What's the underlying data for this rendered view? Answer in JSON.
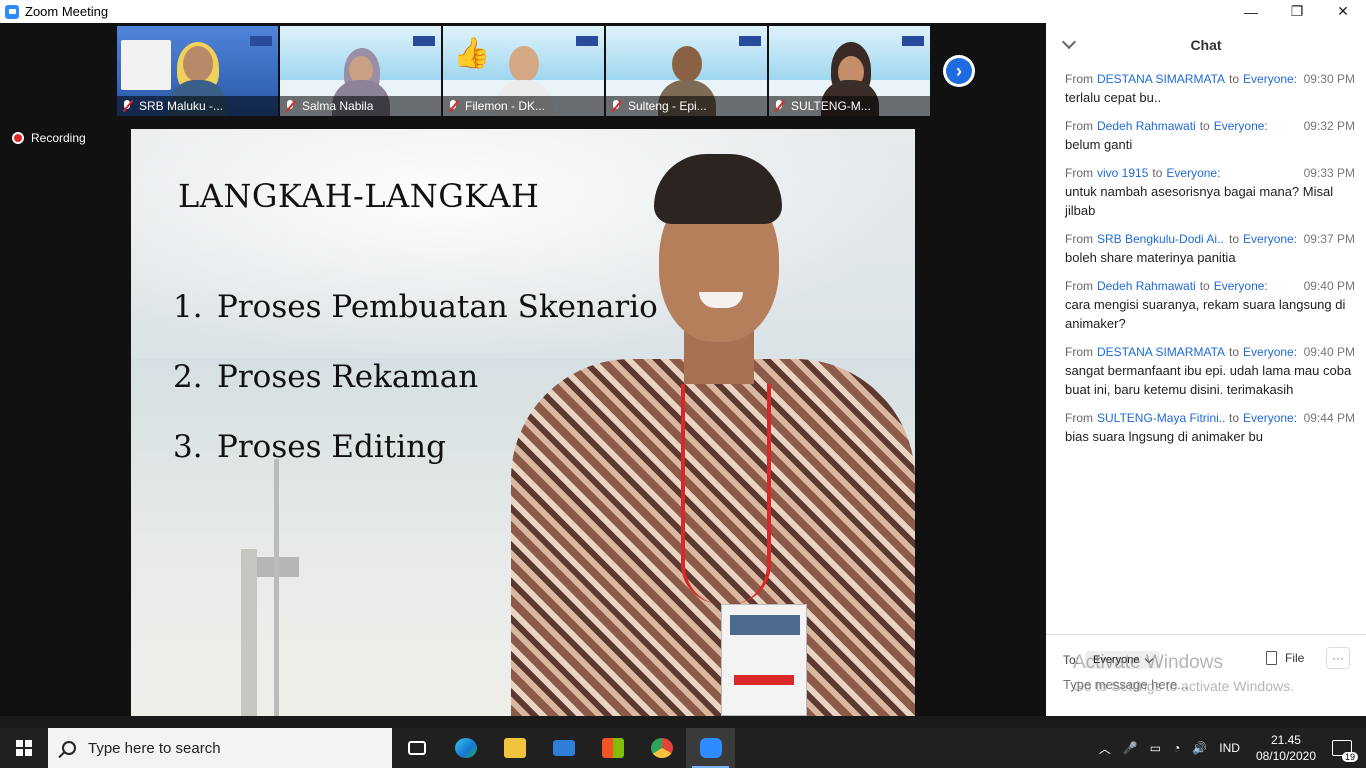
{
  "window": {
    "title": "Zoom Meeting",
    "controls": {
      "minimize": "—",
      "maximize": "❐",
      "close": "✕"
    }
  },
  "gallery": {
    "participants": [
      {
        "name": "SRB Maluku -..."
      },
      {
        "name": "Salma Nabila"
      },
      {
        "name": "Filemon - DK..."
      },
      {
        "name": "Sulteng - Epi..."
      },
      {
        "name": "SULTENG-M..."
      }
    ],
    "next_icon": "›"
  },
  "recording": {
    "label": "Recording"
  },
  "slide": {
    "title": "LANGKAH-LANGKAH",
    "steps": [
      {
        "num": "1.",
        "text": "Proses Pembuatan Skenario"
      },
      {
        "num": "2.",
        "text": "Proses Rekaman"
      },
      {
        "num": "3.",
        "text": "Proses Editing"
      }
    ]
  },
  "chat": {
    "title": "Chat",
    "from_label": "From",
    "to_label": "to",
    "messages": [
      {
        "sender": "DESTANA SIMARMATA...",
        "recipient": "Everyone:",
        "time": "09:30 PM",
        "text": "terlalu cepat bu.."
      },
      {
        "sender": "Dedeh Rahmawati",
        "recipient": "Everyone:",
        "time": "09:32 PM",
        "text": "belum ganti"
      },
      {
        "sender": "vivo 1915",
        "recipient": "Everyone:",
        "time": "09:33 PM",
        "text": "untuk nambah asesorisnya bagai mana? Misal jilbab"
      },
      {
        "sender": "SRB Bengkulu-Dodi Ai...",
        "recipient": "Everyone:",
        "time": "09:37 PM",
        "text": "boleh share materinya panitia"
      },
      {
        "sender": "Dedeh Rahmawati",
        "recipient": "Everyone:",
        "time": "09:40 PM",
        "text": "cara mengisi suaranya, rekam suara langsung di animaker?"
      },
      {
        "sender": "DESTANA SIMARMATA...",
        "recipient": "Everyone:",
        "time": "09:40 PM",
        "text": "sangat bermanfaant ibu epi. udah lama mau coba buat ini, baru ketemu disini. terimakasih"
      },
      {
        "sender": "SULTENG-Maya Fitrini...",
        "recipient": "Everyone:",
        "time": "09:44 PM",
        "text": "bias suara lngsung di animaker bu"
      }
    ],
    "composer": {
      "to_prefix": "To:",
      "recipient": "Everyone",
      "file_label": "File",
      "more_label": "···",
      "placeholder": "Type message here..."
    }
  },
  "watermark": {
    "line1": "Activate Windows",
    "line2": "Go to Settings to activate Windows."
  },
  "taskbar": {
    "search_placeholder": "Type here to search",
    "apps": [
      {
        "name": "task-view",
        "color": "#ffffff"
      },
      {
        "name": "edge",
        "color": "#1ba1e2"
      },
      {
        "name": "file-explorer",
        "color": "#f2c43d"
      },
      {
        "name": "mail",
        "color": "#2f7fd8"
      },
      {
        "name": "store",
        "color": "#f3f3f3"
      },
      {
        "name": "chrome",
        "color": "#e1453a"
      },
      {
        "name": "zoom",
        "color": "#2d8cff"
      }
    ],
    "tray": {
      "chevron": "︿",
      "language": "IND",
      "time": "21.45",
      "date": "08/10/2020",
      "notifications": "19"
    }
  }
}
